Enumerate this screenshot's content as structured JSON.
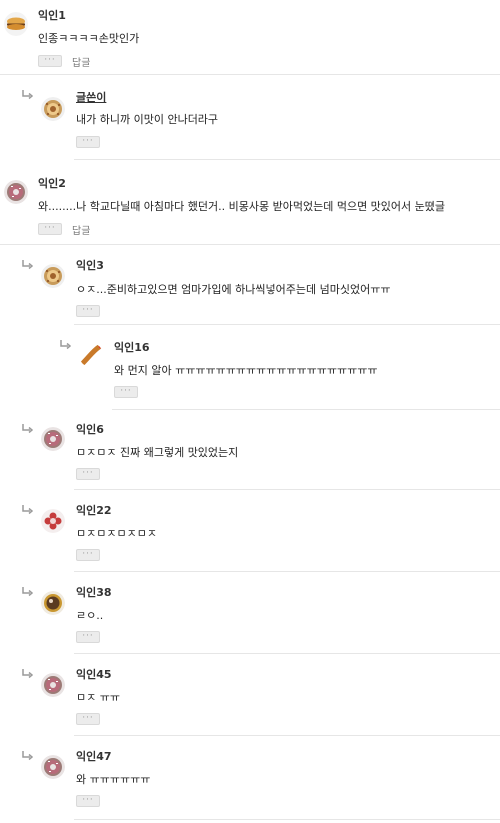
{
  "comments": [
    {
      "nick": "익인1",
      "text": "인종ㅋㅋㅋㅋ손맛인가",
      "more": "···",
      "reply": "답글",
      "avatar": "burger-icon"
    },
    {
      "nick": "글쓴이",
      "text": "내가 하니까 이맛이 안나더라구",
      "more": "···",
      "avatar": "cookie-icon"
    },
    {
      "nick": "익인2",
      "text": "와........나 학교다닐때 아침마다 했던거.. 비몽사몽 받아먹었는데 먹으면 맛있어서 눈뗬글",
      "more": "···",
      "reply": "답글",
      "avatar": "donut-icon"
    },
    {
      "nick": "익인3",
      "text": "ㅇㅈ...준비하고있으면 엄마가입에 하나씩넣어주는데 넘마싯었어ㅠㅠ",
      "more": "···",
      "avatar": "cookie-icon"
    },
    {
      "nick": "익인16",
      "text": "와 먼지 알아 ㅠㅠㅠㅠㅠㅠㅠㅠㅠㅠㅠㅠㅠㅠㅠㅠㅠㅠㅠㅠ",
      "more": "···",
      "avatar": "fried-shrimp-icon"
    },
    {
      "nick": "익인6",
      "text": "ㅁㅈㅁㅈ 진짜 왜그렇게 맛있었는지",
      "more": "···",
      "avatar": "donut-icon"
    },
    {
      "nick": "익인22",
      "text": "ㅁㅈㅁㅈㅁㅈㅁㅈ",
      "more": "···",
      "avatar": "flower-icon"
    },
    {
      "nick": "익인38",
      "text": "ㄹㅇ..",
      "more": "···",
      "avatar": "tart-icon"
    },
    {
      "nick": "익인45",
      "text": "ㅁㅈ ㅠㅠ",
      "more": "···",
      "avatar": "donut-icon"
    },
    {
      "nick": "익인47",
      "text": "와 ㅠㅠㅠㅠㅠㅠ",
      "more": "···",
      "avatar": "donut-icon"
    }
  ]
}
